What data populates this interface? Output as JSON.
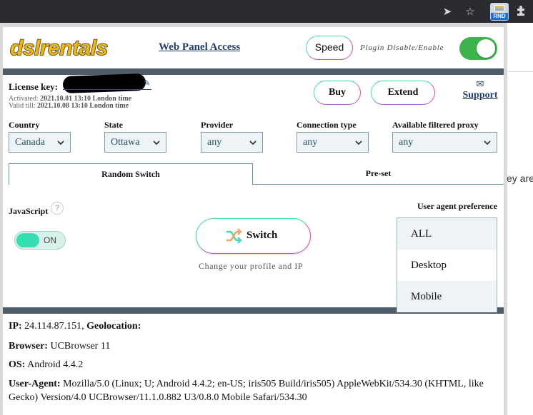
{
  "browser": {
    "icons": [
      "send-icon",
      "star-icon",
      "rnd-extension-icon",
      "puzzle-icon"
    ],
    "rnd_badge": "RND"
  },
  "page_behind": {
    "text_fragment": "ey are"
  },
  "header": {
    "logo_text": "dslrentals",
    "web_panel_link": "Web Panel Access",
    "speed_button": "Speed",
    "plugin_toggle_label": "Plugin Disable/Enable",
    "plugin_enabled": true
  },
  "license": {
    "label": "License key:",
    "activated_prefix": "Activated:",
    "activated": "2021.10.01 13:10 London time",
    "valid_prefix": "Valid till:",
    "valid": "2021.10.08 13:10 London time",
    "buy_button": "Buy",
    "extend_button": "Extend",
    "support_link": "Support"
  },
  "filters": [
    {
      "label": "Country",
      "value": "Canada"
    },
    {
      "label": "State",
      "value": "Ottawa"
    },
    {
      "label": "Provider",
      "value": "any"
    },
    {
      "label": "Connection type",
      "value": "any"
    },
    {
      "label": "Available filtered proxy",
      "value": "any"
    }
  ],
  "tabs": [
    {
      "label": "Random Switch",
      "active": true
    },
    {
      "label": "Pre-set",
      "active": false
    }
  ],
  "javascript": {
    "label": "JavaScript",
    "help": "?",
    "state": "ON"
  },
  "switch": {
    "label": "Switch",
    "caption": "Change your profile and IP"
  },
  "user_agent_pref": {
    "label": "User agent preference",
    "options": [
      "ALL",
      "Desktop",
      "Mobile"
    ]
  },
  "info": {
    "ip_label": "IP:",
    "ip_value": "24.114.87.151,",
    "geo_label": "Geolocation:",
    "browser_label": "Browser:",
    "browser_value": "UCBrowser 11",
    "os_label": "OS:",
    "os_value": "Android 4.4.2",
    "ua_label": "User-Agent:",
    "ua_value": "Mozilla/5.0 (Linux; U; Android 4.4.2; en-US; iris505 Build/iris505) AppleWebKit/534.30 (KHTML, like Gecko) Version/4.0 UCBrowser/11.1.0.882 U3/0.8.0 Mobile Safari/534.30"
  },
  "colors": {
    "frame": "#4f5d6b",
    "accent_teal": "#3fd9b6",
    "accent_pink": "#ea4aa0",
    "toggle_green": "#3cb44b",
    "link_blue": "#233e6e"
  }
}
